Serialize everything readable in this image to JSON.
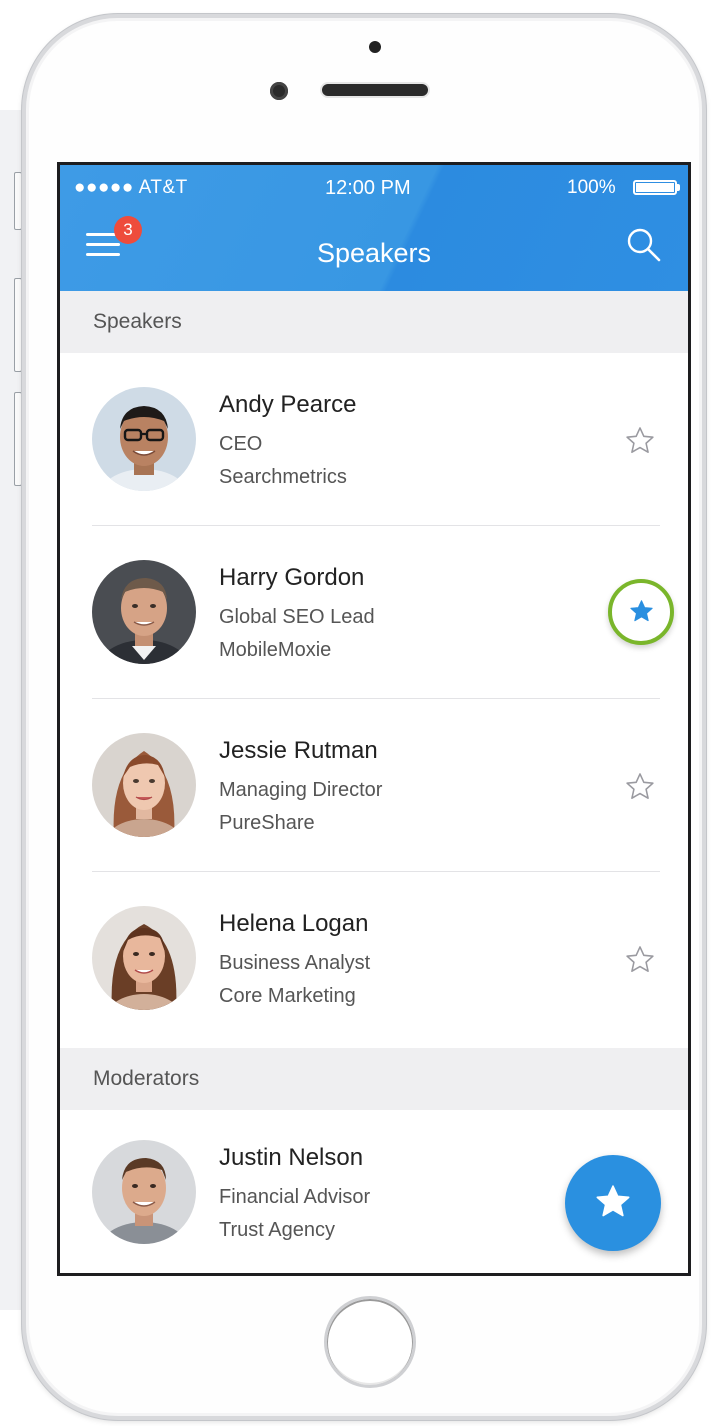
{
  "status_bar": {
    "carrier": "●●●●● AT&T",
    "time": "12:00 PM",
    "battery": "100%"
  },
  "appbar": {
    "title": "Speakers",
    "menu_badge": "3",
    "menu_icon": "hamburger-menu-icon",
    "search_icon": "search-icon"
  },
  "sections": {
    "speakers": {
      "label": "Speakers"
    },
    "moderators": {
      "label": "Moderators"
    }
  },
  "speakers": [
    {
      "name": "Andy Pearce",
      "title": "CEO",
      "company": "Searchmetrics",
      "favorite": false
    },
    {
      "name": "Harry Gordon",
      "title": "Global SEO Lead",
      "company": "MobileMoxie",
      "favorite": true
    },
    {
      "name": "Jessie Rutman",
      "title": "Managing Director",
      "company": "PureShare",
      "favorite": false
    },
    {
      "name": "Helena Logan",
      "title": "Business Analyst",
      "company": "Core Marketing",
      "favorite": false
    }
  ],
  "moderators": [
    {
      "name": "Justin Nelson",
      "title": "Financial Advisor",
      "company": "Trust Agency"
    }
  ],
  "fab": {
    "icon": "star-icon"
  },
  "colors": {
    "accent": "#2f8fe2",
    "badge": "#ee4c3c",
    "highlight_ring": "#7ab62b",
    "section_bg": "#efeff1"
  }
}
